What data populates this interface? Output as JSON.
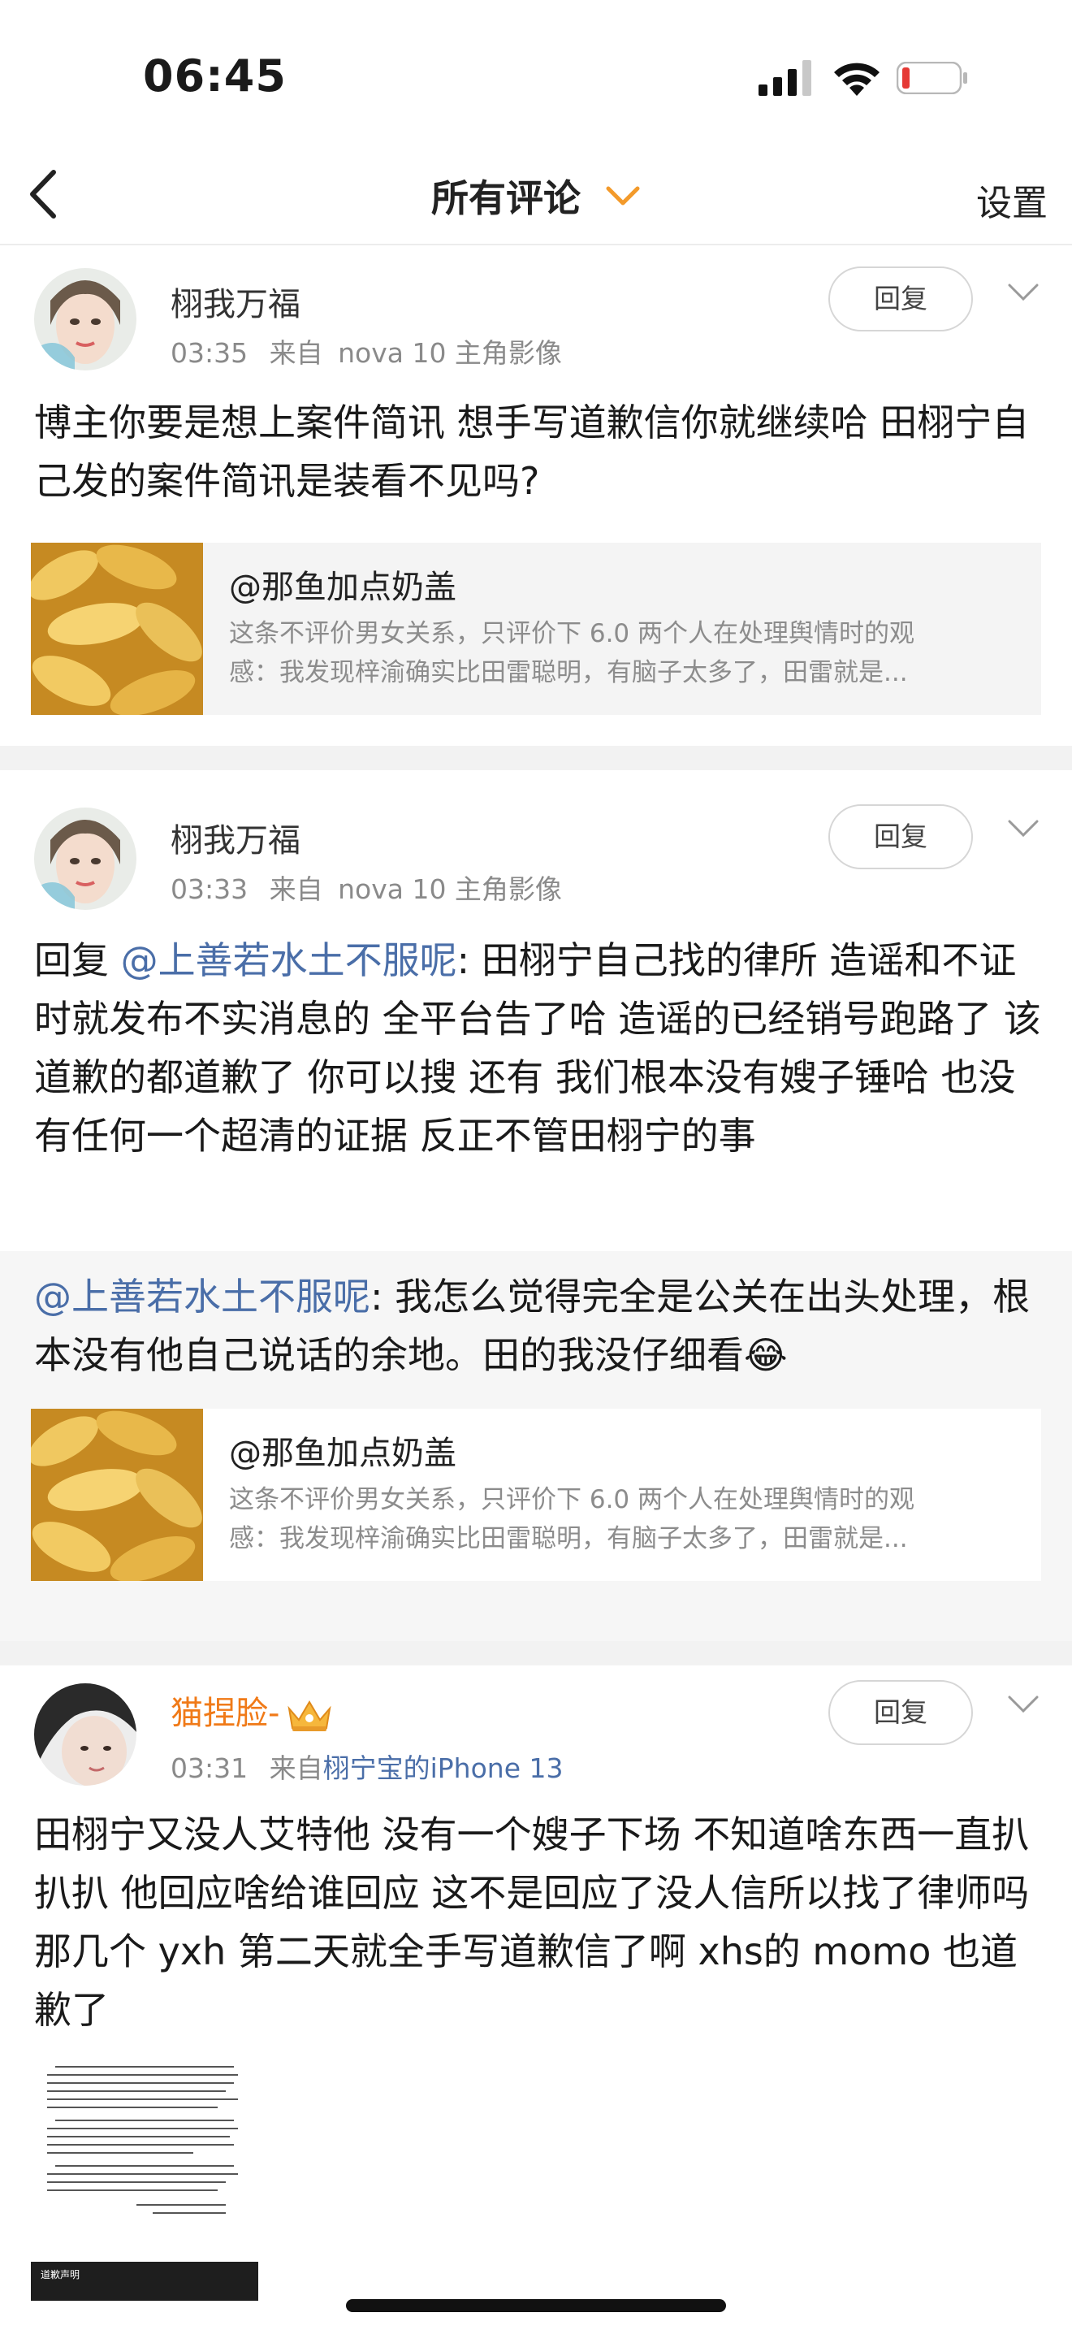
{
  "status_bar": {
    "time": "06:45"
  },
  "nav": {
    "title": "所有评论",
    "settings": "设置"
  },
  "comments": [
    {
      "username": "栩我万福",
      "time": "03:35",
      "source_prefix": "来自",
      "source": "nova 10 主角影像",
      "reply_label": "回复",
      "text": "博主你要是想上案件简讯  想手写道歉信你就继续哈 田栩宁自己发的案件简讯是装看不见吗?",
      "quote": {
        "title": "@那鱼加点奶盖",
        "line1": "这条不评价男女关系，只评价下 6.0 两个人在处理舆情时的观",
        "line2": "感：我发现梓渝确实比田雷聪明，有脑子太多了，田雷就是..."
      }
    },
    {
      "username": "栩我万福",
      "time": "03:33",
      "source_prefix": "来自",
      "source": "nova 10 主角影像",
      "reply_label": "回复",
      "text_prefix": "回复 ",
      "mention": "@上善若水土不服呢",
      "text": ": 田栩宁自己找的律所 造谣和不证时就发布不实消息的 全平台告了哈 造谣的已经销号跑路了 该道歉的都道歉了 你可以搜  还有 我们根本没有嫂子锤哈 也没有任何一个超清的证据 反正不管田栩宁的事",
      "origin": {
        "mention": "@上善若水土不服呢",
        "text": ": 我怎么觉得完全是公关在出头处理，根本没有他自己说话的余地。田的我没仔细看",
        "emoji": "😂"
      },
      "quote": {
        "title": "@那鱼加点奶盖",
        "line1": "这条不评价男女关系，只评价下 6.0 两个人在处理舆情时的观",
        "line2": "感：我发现梓渝确实比田雷聪明，有脑子太多了，田雷就是..."
      }
    },
    {
      "username": "猫捏脸-",
      "time": "03:31",
      "source_prefix": "来自",
      "source": "栩宁宝的iPhone 13",
      "reply_label": "回复",
      "text": "田栩宁又没人艾特他 没有一个嫂子下场 不知道啥东西一直扒扒扒 他回应啥给谁回应 这不是回应了没人信所以找了律师吗 那几个 yxh 第二天就全手写道歉信了啊 xhs的 momo 也道歉了",
      "image_caption": "道歉声明"
    }
  ],
  "colors": {
    "mention": "#4a6ea8",
    "vip_name": "#f07a18",
    "separator": "#f2f2f2"
  }
}
